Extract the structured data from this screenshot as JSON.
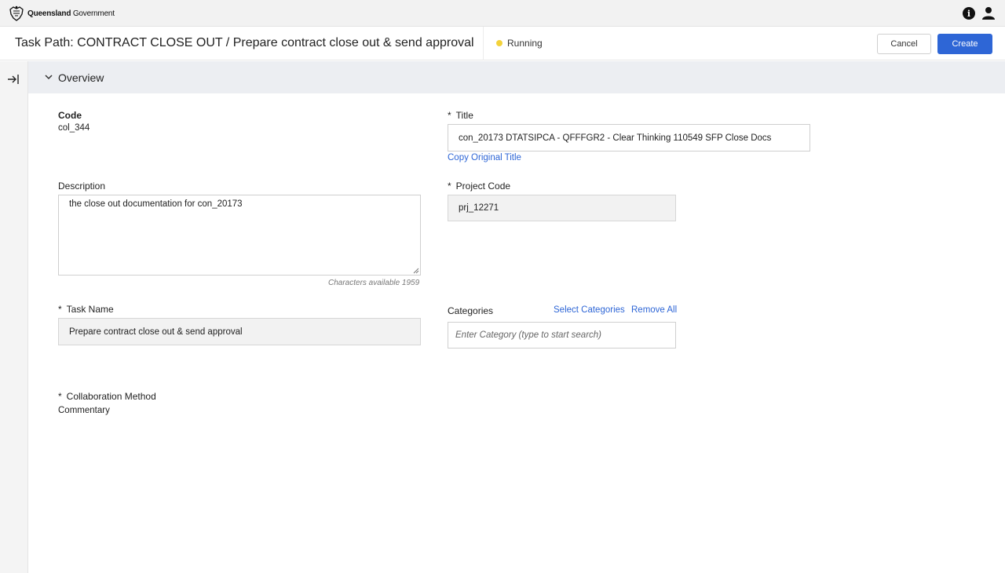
{
  "topbar": {
    "logo_bold": "Queensland",
    "logo_rest": "Government",
    "icons": [
      "info-icon",
      "user-icon"
    ]
  },
  "header": {
    "path_title": "Task Path: CONTRACT CLOSE OUT / Prepare contract close out & send approval",
    "status": "Running",
    "status_color": "#f3d23a",
    "cancel_label": "Cancel",
    "create_label": "Create",
    "accent": "#2e66d6"
  },
  "section": {
    "title": "Overview"
  },
  "form": {
    "code_label": "Code",
    "code_value": "col_344",
    "title_label": "Title",
    "title_value": "con_20173 DTATSIPCA - QFFFGR2 - Clear Thinking 110549 SFP Close Docs",
    "copy_original_title": "Copy Original Title",
    "description_label": "Description",
    "description_value": "the close out documentation for con_20173",
    "characters_available": "Characters available 1959",
    "project_code_label": "Project Code",
    "project_code_value": "prj_12271",
    "task_name_label": "Task Name",
    "task_name_value": "Prepare contract close out & send approval",
    "categories_label": "Categories",
    "select_categories": "Select Categories",
    "remove_all": "Remove All",
    "category_placeholder": "Enter Category (type to start search)",
    "collab_label": "Collaboration Method",
    "collab_value": "Commentary",
    "required_marker": "*"
  }
}
